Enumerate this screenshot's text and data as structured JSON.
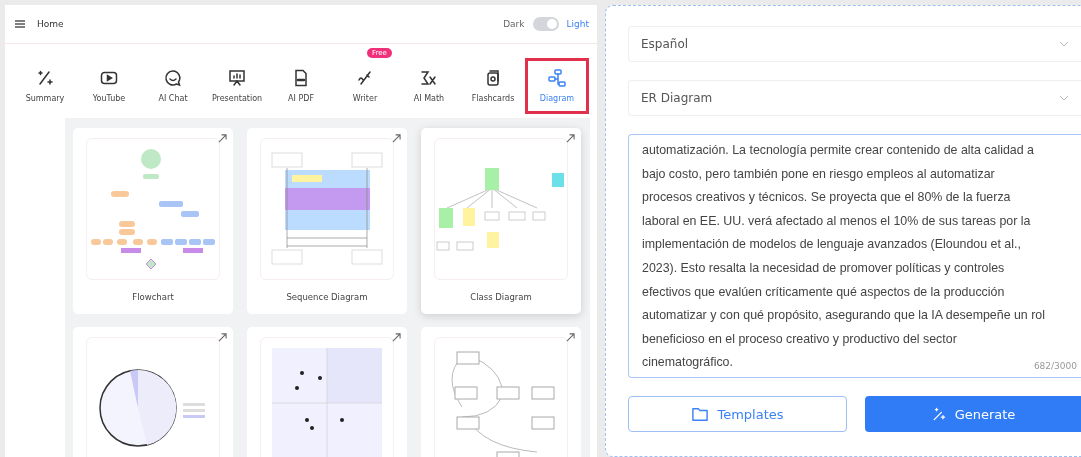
{
  "header": {
    "title": "Home",
    "theme_dark_label": "Dark",
    "theme_light_label": "Light",
    "light_mode": true
  },
  "tools": [
    {
      "label": "Summary",
      "kind": "summary",
      "selected": false
    },
    {
      "label": "YouTube",
      "kind": "youtube",
      "selected": false
    },
    {
      "label": "AI Chat",
      "kind": "chat",
      "selected": false
    },
    {
      "label": "Presentation",
      "kind": "presentation",
      "selected": false
    },
    {
      "label": "AI PDF",
      "kind": "pdf",
      "selected": false
    },
    {
      "label": "Writer",
      "kind": "writer",
      "selected": false,
      "badge": "Free"
    },
    {
      "label": "AI Math",
      "kind": "math",
      "selected": false
    },
    {
      "label": "Flashcards",
      "kind": "flashcards",
      "selected": false
    },
    {
      "label": "Diagram",
      "kind": "diagram",
      "selected": true
    }
  ],
  "templates": [
    {
      "label": "Flowchart",
      "kind": "flowchart",
      "highlighted": false
    },
    {
      "label": "Sequence Diagram",
      "kind": "sequence",
      "highlighted": false
    },
    {
      "label": "Class Diagram",
      "kind": "class",
      "highlighted": true
    },
    {
      "kind": "pie",
      "highlighted": false
    },
    {
      "kind": "quadrant",
      "highlighted": false
    },
    {
      "kind": "er",
      "highlighted": false
    }
  ],
  "form": {
    "language": "Español",
    "diagram_type": "ER Diagram",
    "text": "automatización. La tecnología permite crear contenido de alta calidad a bajo costo, pero también pone en riesgo empleos al automatizar procesos creativos y técnicos. Se proyecta que el 80% de la fuerza laboral en EE. UU. verá afectado al menos el 10% de sus tareas por la implementación de modelos de lenguaje avanzados (Eloundou et al., 2023). Esto resalta la necesidad de promover políticas y controles efectivos que evalúen críticamente qué aspectos de la producción automatizar y con qué propósito, asegurando que la IA desempeñe un rol beneficioso en el proceso creativo y productivo del sector cinematográfico.",
    "counter": "682/3000",
    "templates_button": "Templates",
    "generate_button": "Generate"
  }
}
